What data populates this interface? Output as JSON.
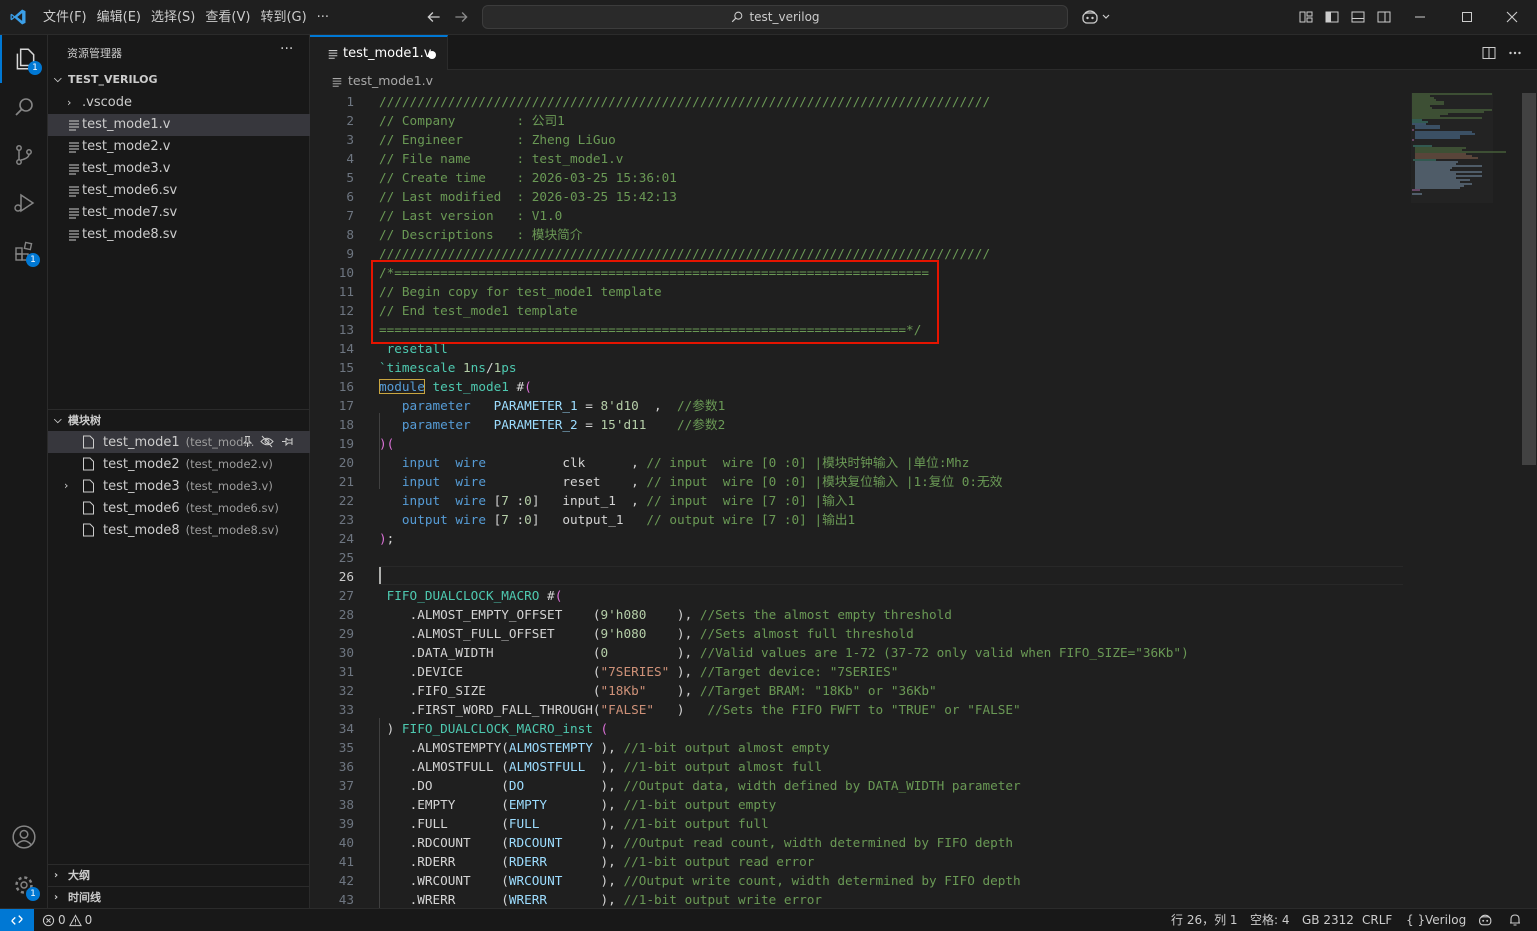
{
  "menu": [
    "文件(F)",
    "编辑(E)",
    "选择(S)",
    "查看(V)",
    "转到(G)",
    "···"
  ],
  "search": {
    "text": "test_verilog"
  },
  "activity_badges": {
    "explorer": "1",
    "extensions": "1",
    "settings": "1"
  },
  "sidebar": {
    "title": "资源管理器",
    "more": "···",
    "folder": "TEST_VERILOG",
    "files": [
      ".vscode",
      "test_mode1.v",
      "test_mode2.v",
      "test_mode3.v",
      "test_mode6.sv",
      "test_mode7.sv",
      "test_mode8.sv"
    ],
    "module_tree": {
      "title": "模块树",
      "items": [
        {
          "name": "test_mode1",
          "desc": "(test_mod..."
        },
        {
          "name": "test_mode2",
          "desc": "(test_mode2.v)"
        },
        {
          "name": "test_mode3",
          "desc": "(test_mode3.v)"
        },
        {
          "name": "test_mode6",
          "desc": "(test_mode6.sv)"
        },
        {
          "name": "test_mode8",
          "desc": "(test_mode8.sv)"
        }
      ]
    },
    "outline": "大纲",
    "timeline": "时间线"
  },
  "tab": {
    "label": "test_mode1.v"
  },
  "breadcrumb": "test_mode1.v",
  "colors": {
    "accent": "#0078d4",
    "comment": "#6a9955",
    "keyword": "#569cd6",
    "type": "#4ec9b0",
    "number": "#b5cea8",
    "string": "#ce9178",
    "variable": "#9cdcfe",
    "directive": "#4ec9b0",
    "func": "#dcdcaa",
    "highlight_box": "#e51400"
  },
  "editor": {
    "current_line": 26,
    "lines": [
      [
        [
          "cm",
          "////////////////////////////////////////////////////////////////////////////////"
        ]
      ],
      [
        [
          "cm",
          "// Company        : 公司1"
        ]
      ],
      [
        [
          "cm",
          "// Engineer       : Zheng LiGuo"
        ]
      ],
      [
        [
          "cm",
          "// File name      : test_mode1.v"
        ]
      ],
      [
        [
          "cm",
          "// Create time    : 2026-03-25 15:36:01"
        ]
      ],
      [
        [
          "cm",
          "// Last modified  : 2026-03-25 15:42:13"
        ]
      ],
      [
        [
          "cm",
          "// Last version   : V1.0"
        ]
      ],
      [
        [
          "cm",
          "// Descriptions   : 模块简介"
        ]
      ],
      [
        [
          "cm",
          "////////////////////////////////////////////////////////////////////////////////"
        ]
      ],
      [
        [
          "cm",
          "/*======================================================================"
        ]
      ],
      [
        [
          "cm",
          "// Begin copy for test_mode1 template"
        ]
      ],
      [
        [
          "cm",
          "// End test_mode1 template"
        ]
      ],
      [
        [
          "cm",
          "=====================================================================*/"
        ]
      ],
      [
        [
          "dir",
          " resetall"
        ]
      ],
      [
        [
          "dir",
          "`timescale "
        ],
        [
          "num",
          "1"
        ],
        [
          "dir",
          "ns"
        ],
        [
          "fg",
          "/"
        ],
        [
          "num",
          "1"
        ],
        [
          "dir",
          "ps"
        ]
      ],
      [
        [
          "kwbox",
          "module"
        ],
        [
          "fg",
          " "
        ],
        [
          "ty",
          "test_mode1"
        ],
        [
          "fg",
          " #"
        ],
        [
          "pk",
          "("
        ]
      ],
      [
        [
          "ws",
          "   "
        ],
        [
          "kw",
          "parameter"
        ],
        [
          "fg",
          "   "
        ],
        [
          "var",
          "PARAMETER_1"
        ],
        [
          "fg",
          " = "
        ],
        [
          "num",
          "8'd10"
        ],
        [
          "fg",
          "  ,  "
        ],
        [
          "cm",
          "//参数1"
        ]
      ],
      [
        [
          "ws",
          "   "
        ],
        [
          "kw",
          "parameter"
        ],
        [
          "fg",
          "   "
        ],
        [
          "var",
          "PARAMETER_2"
        ],
        [
          "fg",
          " = "
        ],
        [
          "num",
          "15'd11"
        ],
        [
          "fg",
          "    "
        ],
        [
          "cm",
          "//参数2"
        ]
      ],
      [
        [
          "pk",
          ")("
        ]
      ],
      [
        [
          "ws",
          "   "
        ],
        [
          "kw",
          "input"
        ],
        [
          "fg",
          "  "
        ],
        [
          "kw",
          "wire"
        ],
        [
          "fg",
          "          "
        ],
        [
          "fg",
          "clk"
        ],
        [
          "fg",
          "      , "
        ],
        [
          "cm",
          "// input  wire [0 :0] |模块时钟输入 |单位:Mhz"
        ]
      ],
      [
        [
          "ws",
          "   "
        ],
        [
          "kw",
          "input"
        ],
        [
          "fg",
          "  "
        ],
        [
          "kw",
          "wire"
        ],
        [
          "fg",
          "          "
        ],
        [
          "fg",
          "reset"
        ],
        [
          "fg",
          "    , "
        ],
        [
          "cm",
          "// input  wire [0 :0] |模块复位输入 |1:复位 0:无效"
        ]
      ],
      [
        [
          "ws",
          "   "
        ],
        [
          "kw",
          "input"
        ],
        [
          "fg",
          "  "
        ],
        [
          "kw",
          "wire"
        ],
        [
          "fg",
          " ["
        ],
        [
          "num",
          "7"
        ],
        [
          "fg",
          " :"
        ],
        [
          "num",
          "0"
        ],
        [
          "fg",
          "]   "
        ],
        [
          "fg",
          "input_1"
        ],
        [
          "fg",
          "  , "
        ],
        [
          "cm",
          "// input  wire [7 :0] |输入1"
        ]
      ],
      [
        [
          "ws",
          "   "
        ],
        [
          "kw",
          "output"
        ],
        [
          "fg",
          " "
        ],
        [
          "kw",
          "wire"
        ],
        [
          "fg",
          " ["
        ],
        [
          "num",
          "7"
        ],
        [
          "fg",
          " :"
        ],
        [
          "num",
          "0"
        ],
        [
          "fg",
          "]   "
        ],
        [
          "fg",
          "output_1"
        ],
        [
          "fg",
          "   "
        ],
        [
          "cm",
          "// output wire [7 :0] |输出1"
        ]
      ],
      [
        [
          "pk",
          ")"
        ],
        [
          "fg",
          ";"
        ]
      ],
      [],
      [],
      [
        [
          "fg",
          " "
        ],
        [
          "ty",
          "FIFO_DUALCLOCK_MACRO"
        ],
        [
          "fg",
          " #"
        ],
        [
          "pk",
          "("
        ]
      ],
      [
        [
          "ws",
          "    "
        ],
        [
          "fg",
          ".ALMOST_EMPTY_OFFSET    ("
        ],
        [
          "num",
          "9'h080"
        ],
        [
          "fg",
          "    ), "
        ],
        [
          "cm",
          "//Sets the almost empty threshold"
        ]
      ],
      [
        [
          "ws",
          "    "
        ],
        [
          "fg",
          ".ALMOST_FULL_OFFSET     ("
        ],
        [
          "num",
          "9'h080"
        ],
        [
          "fg",
          "    ), "
        ],
        [
          "cm",
          "//Sets almost full threshold"
        ]
      ],
      [
        [
          "ws",
          "    "
        ],
        [
          "fg",
          ".DATA_WIDTH             ("
        ],
        [
          "num",
          "0"
        ],
        [
          "fg",
          "         ), "
        ],
        [
          "cm",
          "//Valid values are 1-72 (37-72 only valid when FIFO_SIZE=\"36Kb\")"
        ]
      ],
      [
        [
          "ws",
          "    "
        ],
        [
          "fg",
          ".DEVICE                 ("
        ],
        [
          "str",
          "\"7SERIES\""
        ],
        [
          "fg",
          " ), "
        ],
        [
          "cm",
          "//Target device: \"7SERIES\""
        ]
      ],
      [
        [
          "ws",
          "    "
        ],
        [
          "fg",
          ".FIFO_SIZE              ("
        ],
        [
          "str",
          "\"18Kb\""
        ],
        [
          "fg",
          "    ), "
        ],
        [
          "cm",
          "//Target BRAM: \"18Kb\" or \"36Kb\""
        ]
      ],
      [
        [
          "ws",
          "    "
        ],
        [
          "fg",
          ".FIRST_WORD_FALL_THROUGH("
        ],
        [
          "str",
          "\"FALSE\""
        ],
        [
          "fg",
          "   )   "
        ],
        [
          "cm",
          "//Sets the FIFO FWFT to \"TRUE\" or \"FALSE\""
        ]
      ],
      [
        [
          "fg",
          " ) "
        ],
        [
          "ty",
          "FIFO_DUALCLOCK_MACRO_inst"
        ],
        [
          "fg",
          " "
        ],
        [
          "pk",
          "("
        ]
      ],
      [
        [
          "ws",
          "    "
        ],
        [
          "fg",
          ".ALMOSTEMPTY("
        ],
        [
          "var",
          "ALMOSTEMPTY"
        ],
        [
          "fg",
          " ), "
        ],
        [
          "cm",
          "//1-bit output almost empty"
        ]
      ],
      [
        [
          "ws",
          "    "
        ],
        [
          "fg",
          ".ALMOSTFULL ("
        ],
        [
          "var",
          "ALMOSTFULL"
        ],
        [
          "fg",
          "  ), "
        ],
        [
          "cm",
          "//1-bit output almost full"
        ]
      ],
      [
        [
          "ws",
          "    "
        ],
        [
          "fg",
          ".DO         ("
        ],
        [
          "var",
          "DO"
        ],
        [
          "fg",
          "          ), "
        ],
        [
          "cm",
          "//Output data, width defined by DATA_WIDTH parameter"
        ]
      ],
      [
        [
          "ws",
          "    "
        ],
        [
          "fg",
          ".EMPTY      ("
        ],
        [
          "var",
          "EMPTY"
        ],
        [
          "fg",
          "       ), "
        ],
        [
          "cm",
          "//1-bit output empty"
        ]
      ],
      [
        [
          "ws",
          "    "
        ],
        [
          "fg",
          ".FULL       ("
        ],
        [
          "var",
          "FULL"
        ],
        [
          "fg",
          "        ), "
        ],
        [
          "cm",
          "//1-bit output full"
        ]
      ],
      [
        [
          "ws",
          "    "
        ],
        [
          "fg",
          ".RDCOUNT    ("
        ],
        [
          "var",
          "RDCOUNT"
        ],
        [
          "fg",
          "     ), "
        ],
        [
          "cm",
          "//Output read count, width determined by FIFO depth"
        ]
      ],
      [
        [
          "ws",
          "    "
        ],
        [
          "fg",
          ".RDERR      ("
        ],
        [
          "var",
          "RDERR"
        ],
        [
          "fg",
          "       ), "
        ],
        [
          "cm",
          "//1-bit output read error"
        ]
      ],
      [
        [
          "ws",
          "    "
        ],
        [
          "fg",
          ".WRCOUNT    ("
        ],
        [
          "var",
          "WRCOUNT"
        ],
        [
          "fg",
          "     ), "
        ],
        [
          "cm",
          "//Output write count, width determined by FIFO depth"
        ]
      ],
      [
        [
          "ws",
          "    "
        ],
        [
          "fg",
          ".WRERR      ("
        ],
        [
          "var",
          "WRERR"
        ],
        [
          "fg",
          "       ), "
        ],
        [
          "cm",
          "//1-bit output write error"
        ]
      ]
    ]
  },
  "status": {
    "errors": "0",
    "warnings": "0",
    "position": "行 26，列 1",
    "spaces": "空格: 4",
    "encoding": "GB 2312",
    "eol": "CRLF",
    "language_braces": "{ }",
    "language": "Verilog"
  }
}
